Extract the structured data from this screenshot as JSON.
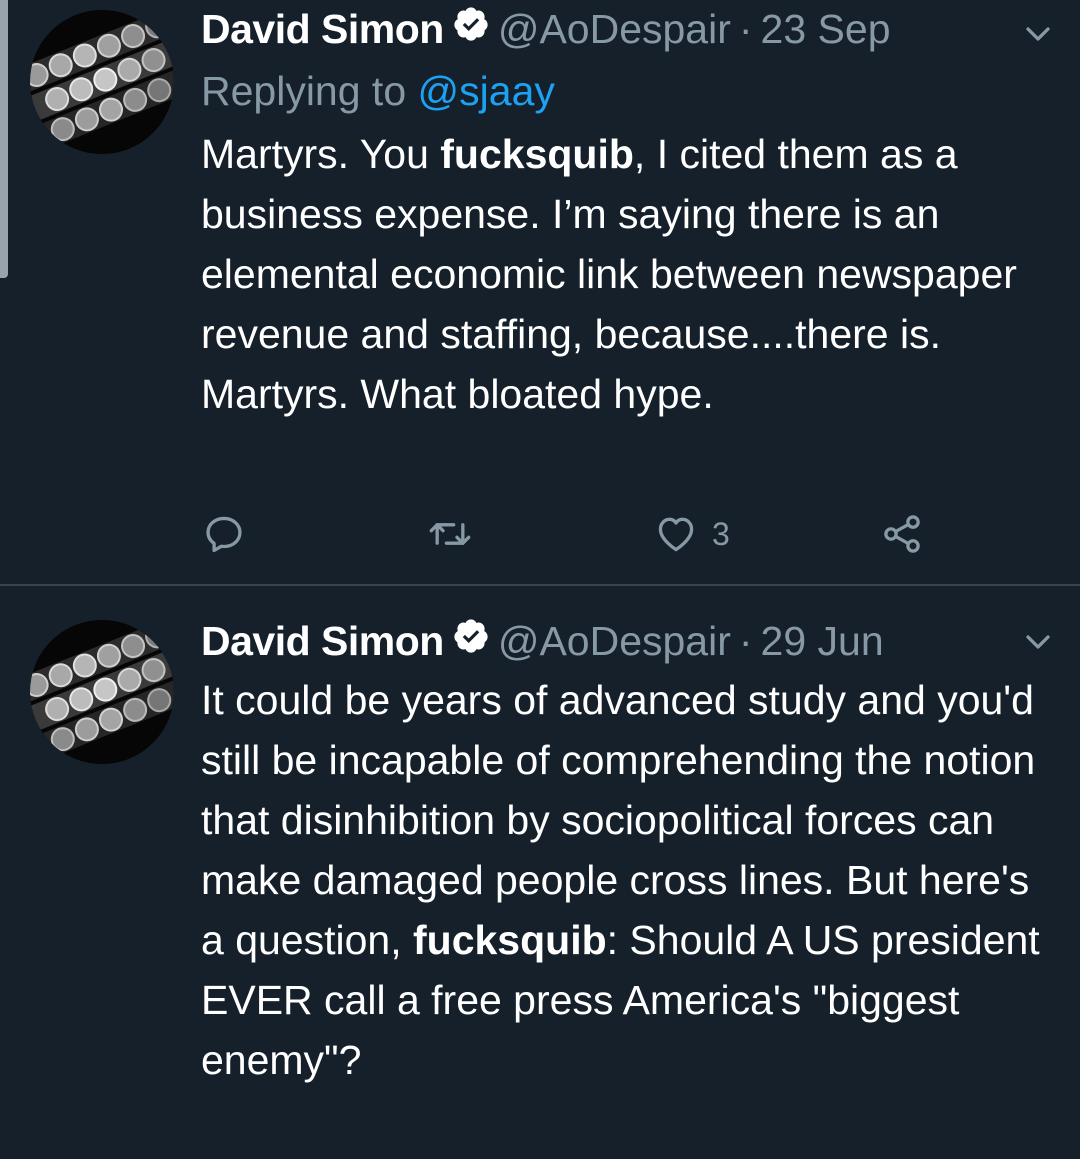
{
  "tweets": [
    {
      "author": "David Simon",
      "handle": "@AoDespair",
      "separator": "·",
      "date": "23 Sep",
      "replying_label": "Replying to",
      "replying_handle": "@sjaay",
      "text_before": "Martyrs. You ",
      "text_bold": "fucksquib",
      "text_after": ", I cited them as a business expense. I’m saying there is an elemental economic link between newspaper revenue and staffing, because....there is. Martyrs. What bloated hype.",
      "like_count": "3"
    },
    {
      "author": "David Simon",
      "handle": "@AoDespair",
      "separator": "·",
      "date": "29 Jun",
      "text_before": "It could be years of advanced study and you'd still be incapable of comprehending the notion that disinhibition by sociopolitical forces can make damaged people cross lines. But here's a question, ",
      "text_bold": "fucksquib",
      "text_after": ": Should A US president EVER call a free press America's \"biggest enemy\"?"
    }
  ],
  "icons": {
    "verified": "verified-badge-icon",
    "caret": "chevron-down-icon",
    "reply": "reply-bubble-icon",
    "retweet": "retweet-icon",
    "like": "heart-icon",
    "share": "share-icon"
  },
  "colors": {
    "background": "#15202b",
    "text": "#ffffff",
    "secondary": "#8899a6",
    "link": "#1da1f2",
    "divider": "#38444d"
  }
}
